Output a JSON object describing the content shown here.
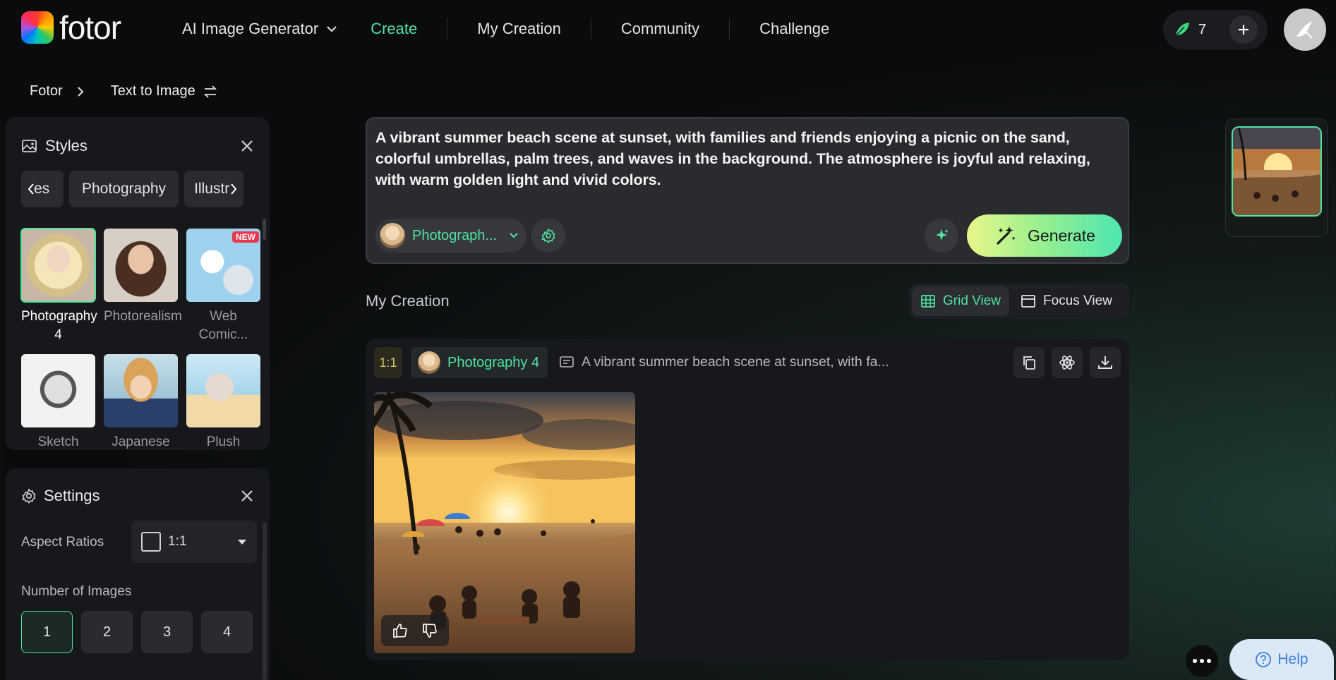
{
  "brand": {
    "name": "fotor"
  },
  "nav": {
    "items": [
      {
        "label": "AI Image Generator"
      },
      {
        "label": "Create"
      },
      {
        "label": "My Creation"
      },
      {
        "label": "Community"
      },
      {
        "label": "Challenge"
      }
    ]
  },
  "account": {
    "credits": "7"
  },
  "breadcrumb": {
    "root": "Fotor",
    "current": "Text to Image"
  },
  "styles_panel": {
    "title": "Styles",
    "tabs": [
      "es",
      "Photography",
      "Illustr"
    ],
    "cards": [
      {
        "name": "Photography 4",
        "selected": true
      },
      {
        "name": "Photorealism"
      },
      {
        "name": "Web Comic...",
        "badge": "NEW"
      },
      {
        "name": "Sketch"
      },
      {
        "name": "Japanese"
      },
      {
        "name": "Plush"
      }
    ]
  },
  "settings_panel": {
    "title": "Settings",
    "aspect_label": "Aspect Ratios",
    "aspect_value": "1:1",
    "images_label": "Number of Images",
    "image_counts": [
      "1",
      "2",
      "3",
      "4"
    ],
    "selected_count": "1"
  },
  "prompt": {
    "text": "A vibrant summer beach scene at sunset, with families and friends enjoying a picnic on the sand, colorful umbrellas, palm trees, and waves in the background. The atmosphere is joyful and relaxing, with warm golden light and vivid colors.",
    "style_label": "Photograph...",
    "generate_label": "Generate"
  },
  "creation": {
    "title": "My Creation",
    "grid_view_label": "Grid View",
    "focus_view_label": "Focus View",
    "ratio": "1:1",
    "model": "Photography 4",
    "prompt_excerpt": "A vibrant summer beach scene at sunset, with fa..."
  },
  "help": {
    "label": "Help"
  },
  "colors": {
    "accent": "#4fe3a0",
    "generate_start": "#e8f78a",
    "generate_end": "#4ee6b0"
  }
}
